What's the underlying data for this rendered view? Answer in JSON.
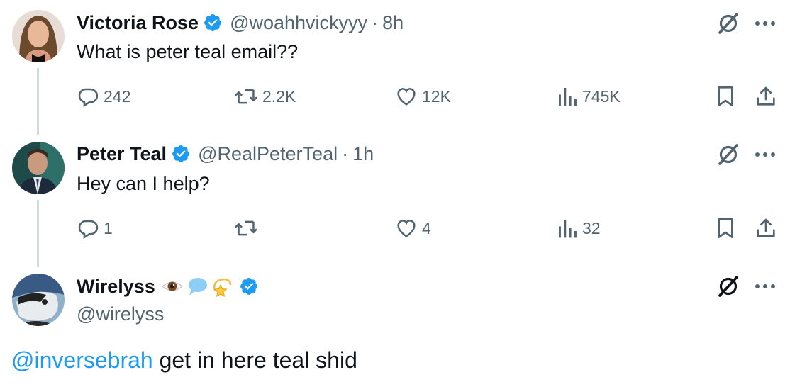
{
  "tweets": [
    {
      "name": "Victoria Rose",
      "handle": "@woahhvickyyy",
      "time": "8h",
      "text": "What is peter teal email??",
      "replies": "242",
      "retweets": "2.2K",
      "likes": "12K",
      "views": "745K"
    },
    {
      "name": "Peter Teal",
      "handle": "@RealPeterTeal",
      "time": "1h",
      "text": "Hey can I help?",
      "replies": "1",
      "retweets": "",
      "likes": "4",
      "views": "32"
    }
  ],
  "reply": {
    "name": "Wirelyss",
    "name_emojis": [
      "eye-emoji",
      "speech-bubble-emoji",
      "dizzy-star-emoji"
    ],
    "handle": "@wirelyss",
    "mention": "@inversebrah",
    "text": " get in here teal shid"
  },
  "colors": {
    "accent": "#1d9bf0",
    "secondary_text": "#536471",
    "thread_line": "#cfd9de"
  }
}
